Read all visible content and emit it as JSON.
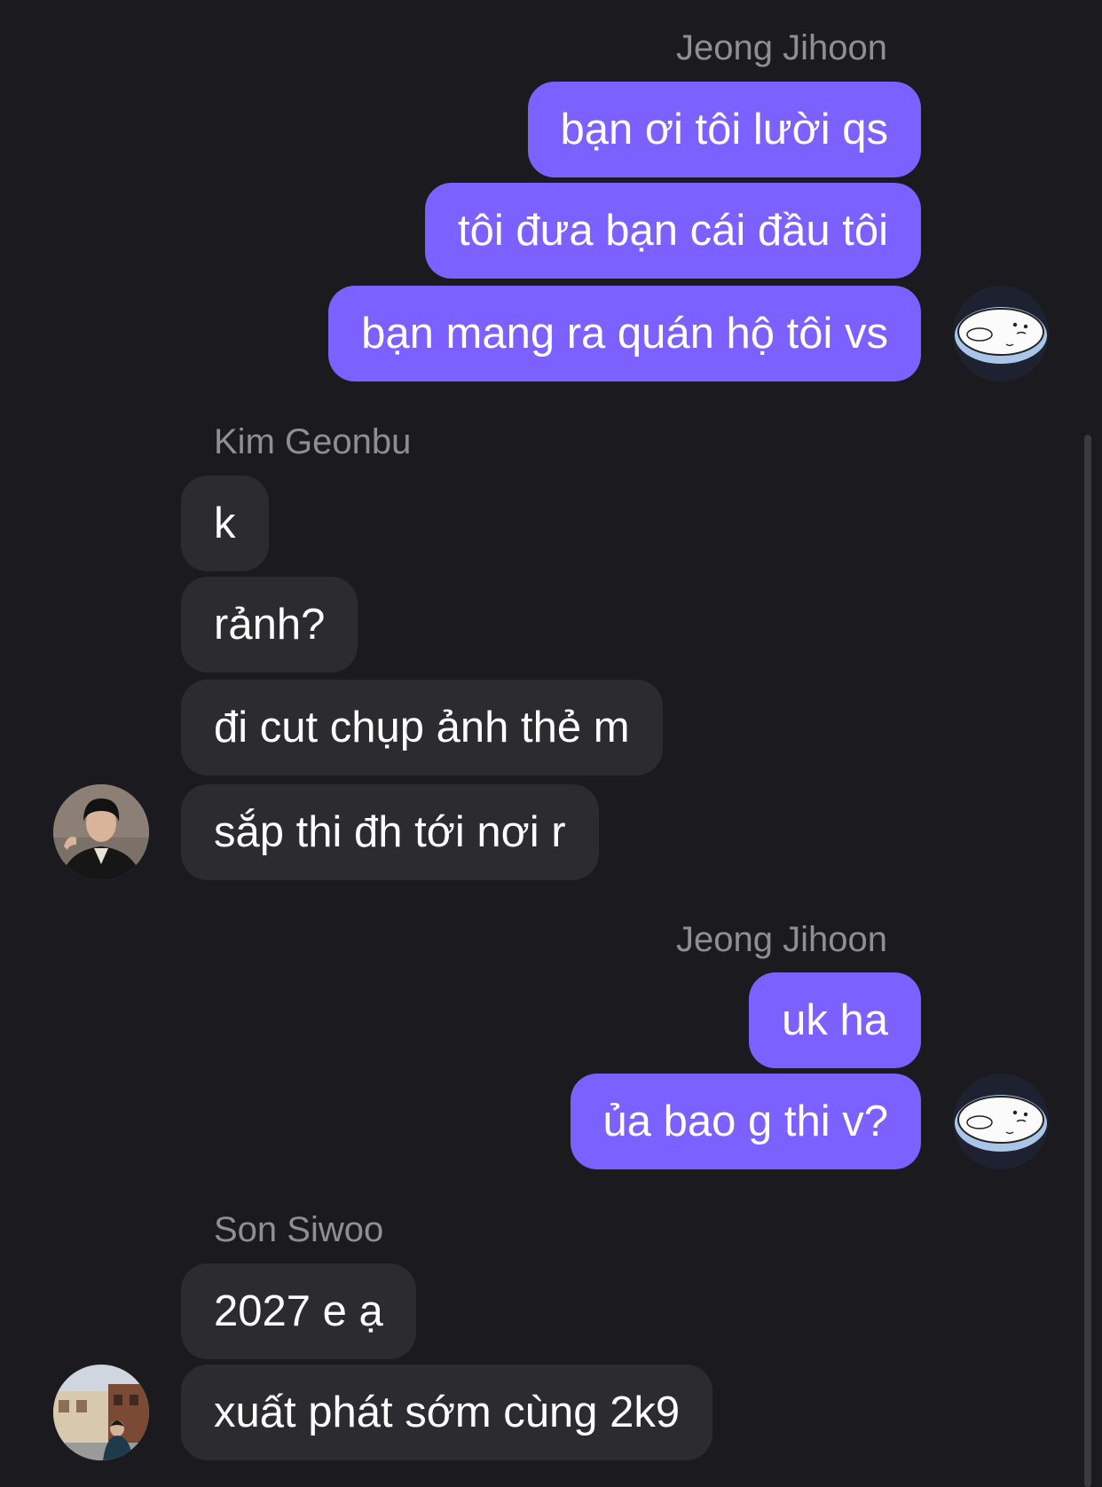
{
  "messages": [
    {
      "sender": "Jeong Jihoon",
      "direction": "outgoing",
      "bubbles": [
        "bạn ơi tôi lười qs",
        "tôi đưa bạn cái đầu tôi",
        "bạn mang ra quán hộ tôi vs"
      ],
      "avatar_icon": "seal-sticker-icon"
    },
    {
      "sender": "Kim Geonbu",
      "direction": "incoming",
      "bubbles": [
        "k",
        "rảnh?",
        "đi cut chụp ảnh thẻ m",
        "sắp thi đh tới nơi r"
      ],
      "avatar_icon": "person-photo-avatar"
    },
    {
      "sender": "Jeong Jihoon",
      "direction": "outgoing",
      "bubbles": [
        "uk ha",
        "ủa bao g thi v?"
      ],
      "avatar_icon": "seal-sticker-icon"
    },
    {
      "sender": "Son Siwoo",
      "direction": "incoming",
      "bubbles": [
        "2027 e ạ",
        "xuất phát sớm cùng 2k9"
      ],
      "avatar_icon": "person-street-photo-avatar"
    }
  ],
  "colors": {
    "background": "#1b1b1f",
    "outgoing_bubble": "#7b61ff",
    "incoming_bubble": "#2c2c30",
    "sender_name": "#8e8e94"
  }
}
